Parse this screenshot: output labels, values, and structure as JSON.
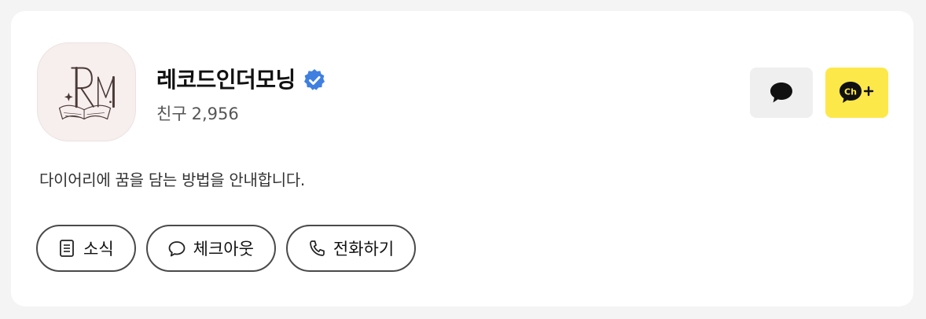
{
  "channel": {
    "name": "레코드인더모닝",
    "verified": true,
    "friends_label": "친구",
    "friends_count": "2,956",
    "description": "다이어리에 꿈을 담는 방법을 안내합니다.",
    "logo_icon": "record-in-the-morning-logo",
    "logo_background": "#f7eeee"
  },
  "actions": {
    "chat_icon": "speech-bubble-icon",
    "chat_bg": "#efefef",
    "add_channel_icon": "kakao-channel-add-icon",
    "add_channel_bg": "#fde84a"
  },
  "pills": [
    {
      "label": "소식",
      "icon": "document-icon"
    },
    {
      "label": "체크아웃",
      "icon": "chat-bubble-icon"
    },
    {
      "label": "전화하기",
      "icon": "phone-icon"
    }
  ],
  "colors": {
    "verified_badge": "#3f7fe0",
    "pill_border": "#4a4a4a"
  }
}
